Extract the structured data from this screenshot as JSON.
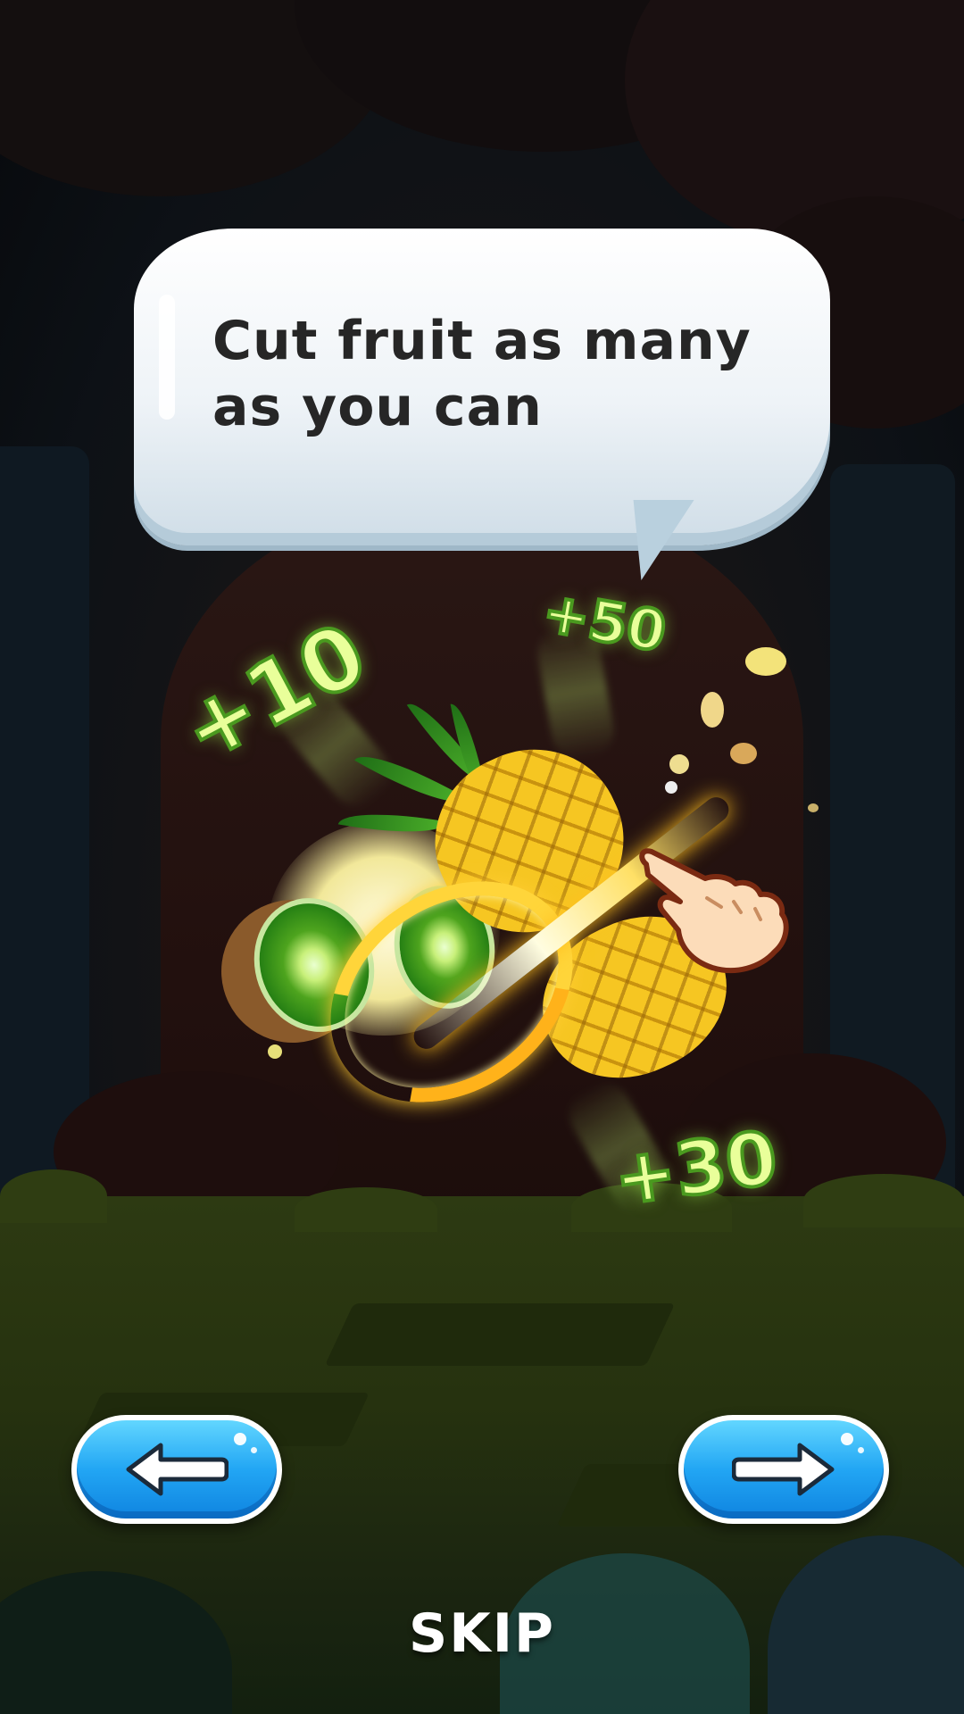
{
  "tutorial": {
    "message_line1": "Cut fruit as many",
    "message_line2": "as you can"
  },
  "scores": {
    "popup_a": "+10",
    "popup_b": "+50",
    "popup_c": "+30"
  },
  "navigation": {
    "back_icon": "arrow-left-icon",
    "next_icon": "arrow-right-icon",
    "skip_label": "SKIP"
  },
  "colors": {
    "button_blue": "#22a6f4",
    "score_green": "#4a9a1f",
    "slash_yellow": "#ffd53a"
  }
}
